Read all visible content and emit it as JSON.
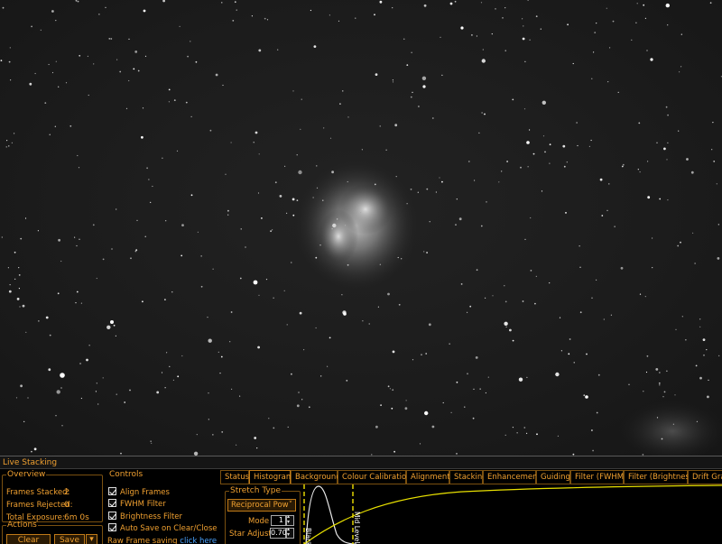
{
  "panel": {
    "title": "Live Stacking"
  },
  "overview": {
    "legend": "Overview",
    "frames_stacked_label": "Frames Stacked:",
    "frames_stacked_value": "2",
    "frames_rejected_label": "Frames Rejected:",
    "frames_rejected_value": "0",
    "total_exposure_label": "Total Exposure:",
    "total_exposure_value": "6m 0s"
  },
  "actions": {
    "legend": "Actions",
    "clear_label": "Clear",
    "save_label": "Save"
  },
  "controls": {
    "legend": "Controls",
    "align_frames": "Align Frames",
    "fwhm_filter": "FWHM Filter",
    "brightness_filter": "Brightness Filter",
    "auto_save": "Auto Save on Clear/Close",
    "raw_frame_label": "Raw Frame saving",
    "raw_frame_link": "click here"
  },
  "tabs": [
    "Status",
    "Histogram",
    "Background",
    "Colour Calibration",
    "Alignment",
    "Stacking",
    "Enhancement",
    "Guiding",
    "Filter (FWHM)",
    "Filter (Brightness)",
    "Drift Grap"
  ],
  "active_tab": "Histogram",
  "stretch": {
    "legend": "Stretch Type",
    "type_value": "Reciprocal Pow",
    "mode_label": "Mode",
    "mode_value": "1",
    "star_adjust_label": "Star Adjust",
    "star_adjust_value": "0.70"
  },
  "histogram": {
    "black_label": "Black",
    "mid_label": "Mid Level",
    "curve_color": "#e8e000",
    "marker_color": "#f0e000",
    "histogram_color": "#e8e8e8"
  },
  "colors": {
    "accent": "#f0a030",
    "border": "#7a5010",
    "link": "#4aa3ff",
    "sky": "#1d1d1d"
  }
}
